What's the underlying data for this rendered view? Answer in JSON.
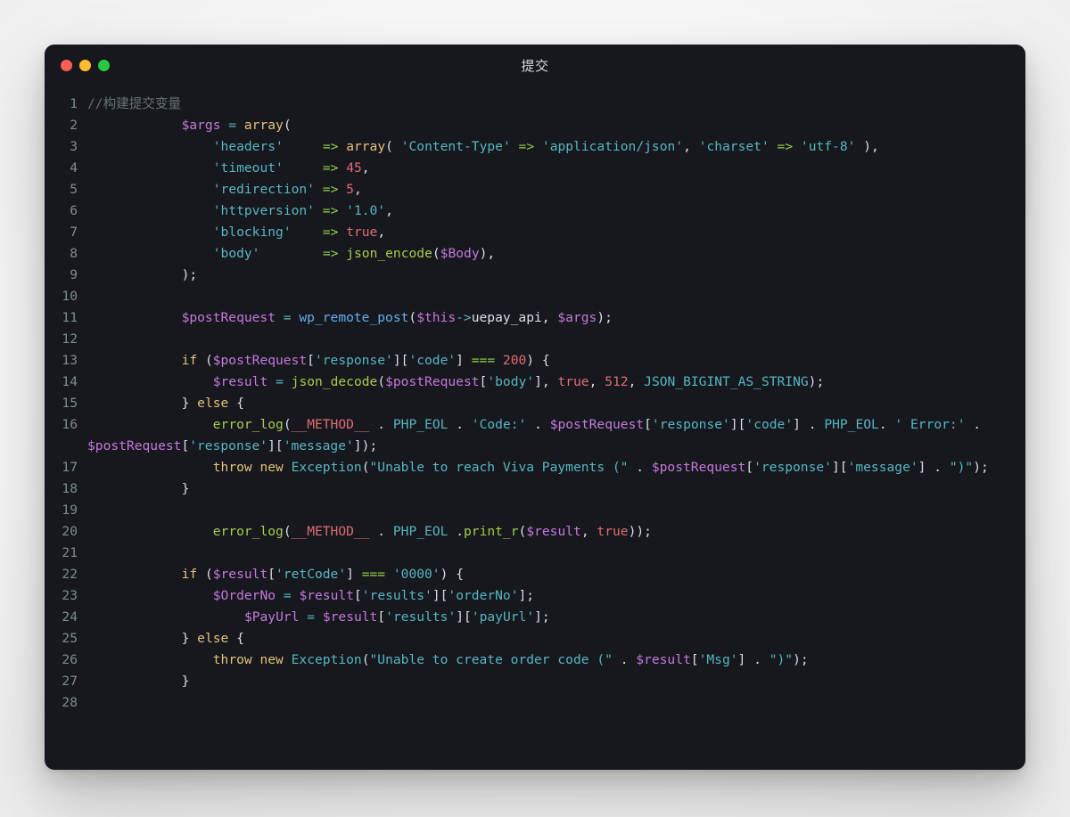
{
  "window": {
    "title": "提交",
    "traffic_lights": [
      {
        "name": "close",
        "color": "#ff5f57"
      },
      {
        "name": "minimize",
        "color": "#febc2e"
      },
      {
        "name": "maximize",
        "color": "#28c840"
      }
    ]
  },
  "editor": {
    "language": "php",
    "theme": "one-dark",
    "background": "#16181d",
    "line_number_color": "#7f8e8b",
    "first_line": 1,
    "last_line": 28,
    "lines": [
      {
        "n": "1",
        "text": "//构建提交变量"
      },
      {
        "n": "2",
        "text": "            $args = array("
      },
      {
        "n": "3",
        "text": "                'headers'     => array( 'Content-Type' => 'application/json', 'charset' => 'utf-8' ),"
      },
      {
        "n": "4",
        "text": "                'timeout'     => 45,"
      },
      {
        "n": "5",
        "text": "                'redirection' => 5,"
      },
      {
        "n": "6",
        "text": "                'httpversion' => '1.0',"
      },
      {
        "n": "7",
        "text": "                'blocking'    => true,"
      },
      {
        "n": "8",
        "text": "                'body'        => json_encode($Body),"
      },
      {
        "n": "9",
        "text": "            );"
      },
      {
        "n": "10",
        "text": ""
      },
      {
        "n": "11",
        "text": "            $postRequest = wp_remote_post($this->uepay_api, $args);"
      },
      {
        "n": "12",
        "text": ""
      },
      {
        "n": "13",
        "text": "            if ($postRequest['response']['code'] === 200) {"
      },
      {
        "n": "14",
        "text": "                $result = json_decode($postRequest['body'], true, 512, JSON_BIGINT_AS_STRING);"
      },
      {
        "n": "15",
        "text": "            } else {"
      },
      {
        "n": "16",
        "text": "                error_log(__METHOD__ . PHP_EOL . 'Code:' . $postRequest['response']['code'] . PHP_EOL. ' Error:' . $postRequest['response']['message']);"
      },
      {
        "n": "17",
        "text": "                throw new Exception(\"Unable to reach Viva Payments (\" . $postRequest['response']['message'] . \")\");"
      },
      {
        "n": "18",
        "text": "            }"
      },
      {
        "n": "19",
        "text": ""
      },
      {
        "n": "20",
        "text": "                error_log(__METHOD__ . PHP_EOL .print_r($result, true));"
      },
      {
        "n": "21",
        "text": ""
      },
      {
        "n": "22",
        "text": "            if ($result['retCode'] === '0000') {"
      },
      {
        "n": "23",
        "text": "                $OrderNo = $result['results']['orderNo'];"
      },
      {
        "n": "24",
        "text": "                    $PayUrl = $result['results']['payUrl'];"
      },
      {
        "n": "25",
        "text": "            } else {"
      },
      {
        "n": "26",
        "text": "                throw new Exception(\"Unable to create order code (\" . $result['Msg'] . \")\");"
      },
      {
        "n": "27",
        "text": "            }"
      },
      {
        "n": "28",
        "text": ""
      }
    ],
    "token_colors": {
      "comment": "#687276",
      "variable": "#c678dd",
      "operator": "#94d04f",
      "function": "#a6cc4c",
      "builtin": "#56b6c2",
      "keyword": "#e5c07b",
      "string": "#56b6c2",
      "number": "#e06c75",
      "constant": "#e06c75",
      "plain": "#d8dee9"
    }
  }
}
